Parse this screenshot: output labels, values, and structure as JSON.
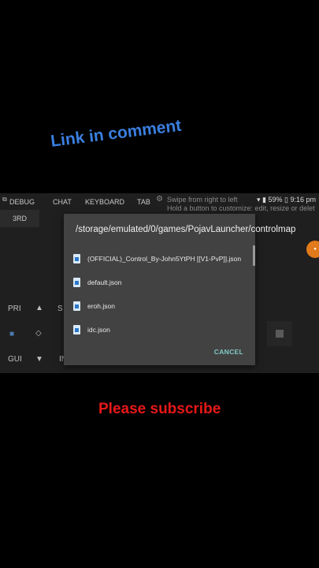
{
  "overlay": {
    "top_caption": "Link in comment",
    "bottom_caption": "Please subscribe"
  },
  "topbar": {
    "debug": "DEBUG",
    "chat": "CHAT",
    "keyboard": "KEYBOARD",
    "tab": "TAB",
    "third": "3RD",
    "hint_line1": "Swipe from right to left",
    "hint_line2": "Hold a button to customize: edit, resize or delete"
  },
  "status_bar": {
    "battery": "59%",
    "time": "9:16 pm"
  },
  "controls": {
    "pri": "PRI",
    "up": "▲",
    "s": "S",
    "diamond": "◇",
    "gui": "GUI",
    "down": "▼",
    "in": "IN"
  },
  "dialog": {
    "path": "/storage/emulated/0/games/PojavLauncher/controlmap",
    "files": [
      "(OFFICIAL)_Control_By-John5YtPH [[V1-PvP]].json",
      "default.json",
      "eroh.json",
      "idc.json"
    ],
    "cancel": "CANCEL"
  }
}
